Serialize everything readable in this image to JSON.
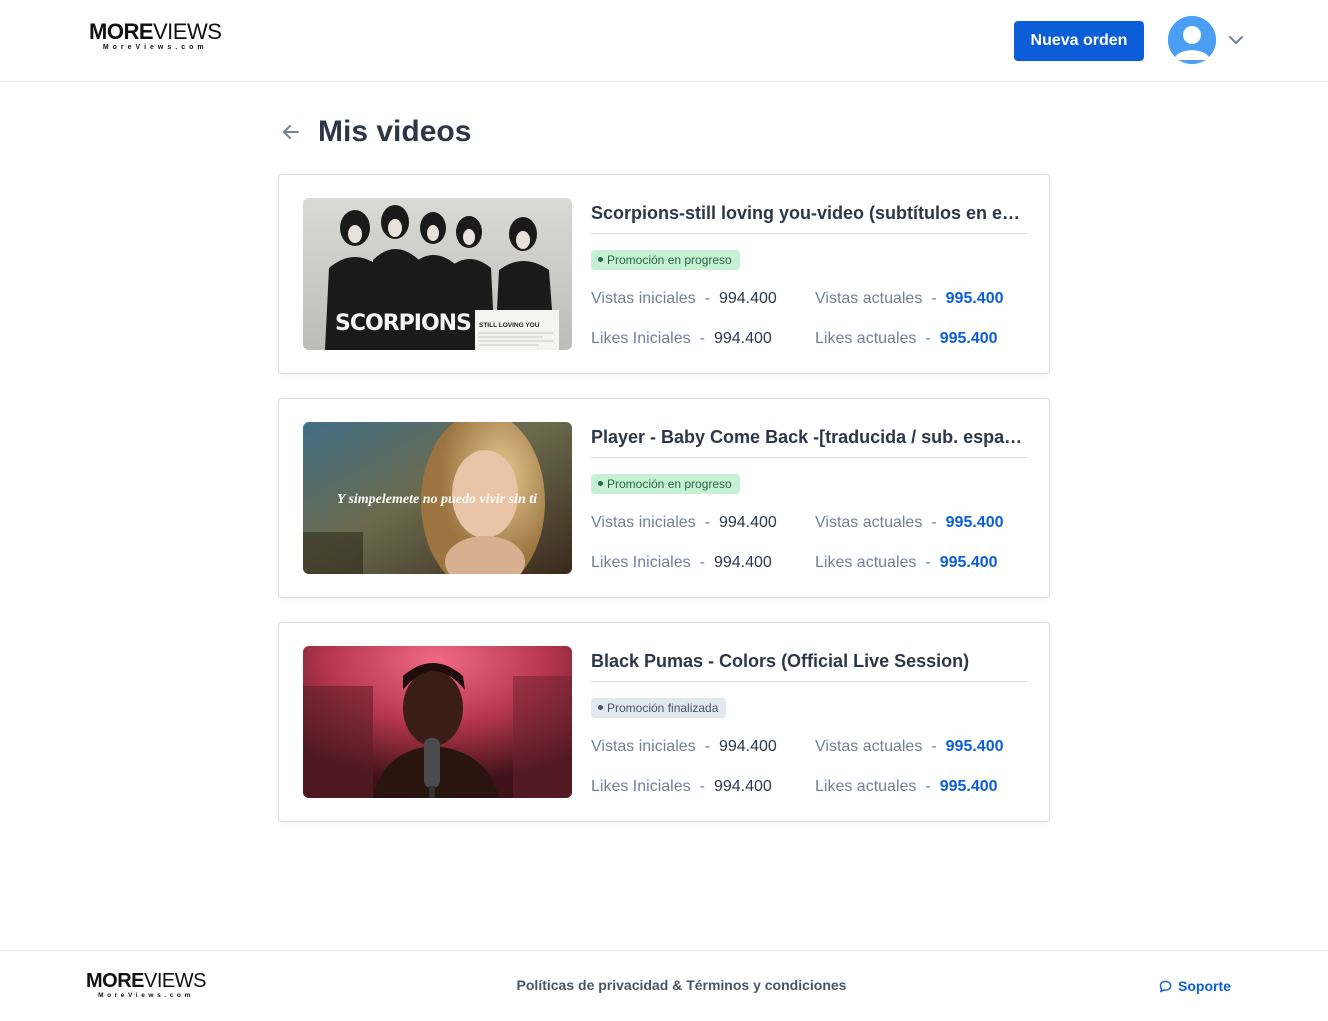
{
  "header": {
    "logo_main_bold": "MORE",
    "logo_main_thin": "VIEWS",
    "logo_sub": "MoreViews.com",
    "new_order_label": "Nueva orden"
  },
  "page": {
    "title": "Mis videos"
  },
  "labels": {
    "initial_views": "Vistas iniciales",
    "current_views": "Vistas actuales",
    "initial_likes": "Likes Iniciales",
    "current_likes": "Likes actuales",
    "separator": "-"
  },
  "videos": [
    {
      "title": "Scorpions-still loving you-video (subtítulos en español)",
      "status": "Promoción en progreso",
      "initial_views": "994.400",
      "current_views": "995.400",
      "initial_likes": "994.400",
      "current_likes": "995.400",
      "thumb_band": "SCORPIONS",
      "thumb_song": "STILL LOVING YOU"
    },
    {
      "title": "Player - Baby Come Back -[traducida / sub. español]",
      "status": "Promoción en progreso",
      "initial_views": "994.400",
      "current_views": "995.400",
      "initial_likes": "994.400",
      "current_likes": "995.400",
      "thumb_caption": "Y simpelemete no puedo vivir sin ti"
    },
    {
      "title": "Black Pumas - Colors (Official Live Session)",
      "status": "Promoción finalizada",
      "initial_views": "994.400",
      "current_views": "995.400",
      "initial_likes": "994.400",
      "current_likes": "995.400"
    }
  ],
  "footer": {
    "logo_main_bold": "MORE",
    "logo_main_thin": "VIEWS",
    "logo_sub": "MoreViews.com",
    "privacy_label": "Políticas de privacidad",
    "amp": "&",
    "terms_label": "Términos y condiciones",
    "support_label": "Soporte"
  },
  "colors": {
    "primary": "#0b5ed7",
    "progress_badge_bg": "#c6f0d4",
    "done_badge_bg": "#e2e8f0",
    "avatar": "#4a9ff5"
  },
  "icons": {
    "back": "arrow-left-icon",
    "avatar": "user-avatar-icon",
    "dropdown": "chevron-down-icon",
    "support": "chat-bubble-icon"
  }
}
